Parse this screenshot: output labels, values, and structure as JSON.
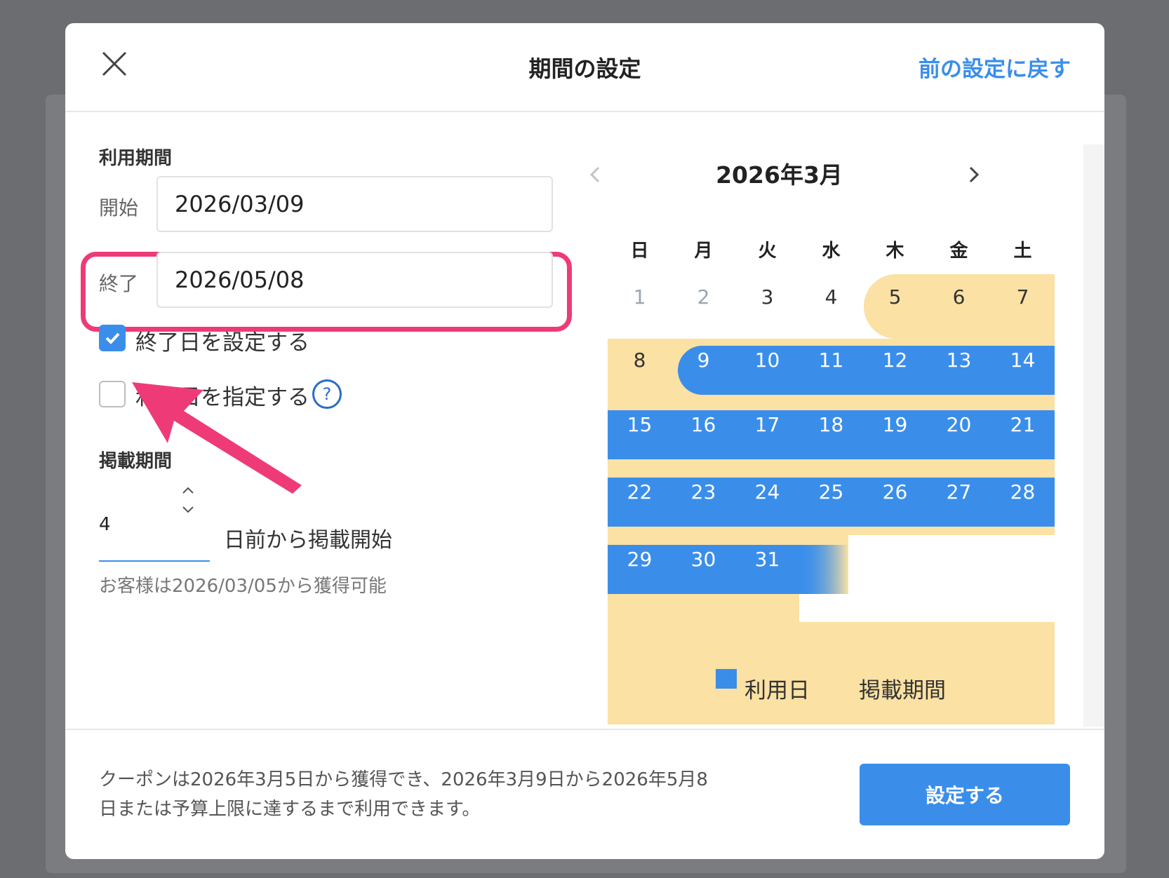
{
  "modal": {
    "title": "期間の設定",
    "reset_link": "前の設定に戻す"
  },
  "usage_period": {
    "section_title": "利用期間",
    "start_label": "開始",
    "start_value": "2026/03/09",
    "end_label": "終了",
    "end_value": "2026/05/08",
    "set_end_date_label": "終了日を設定する",
    "set_end_date_checked": true,
    "specify_usage_days_label": "利用日を指定する",
    "specify_usage_days_checked": false,
    "help_symbol": "?"
  },
  "publish_period": {
    "section_title": "掲載期間",
    "days_before_value": "4",
    "days_before_suffix": "日前から掲載開始",
    "note": "お客様は2026/03/05から獲得可能"
  },
  "calendar": {
    "month_label": "2026年3月",
    "weekdays": [
      "日",
      "月",
      "火",
      "水",
      "木",
      "金",
      "土"
    ],
    "weeks": [
      [
        "1",
        "2",
        "3",
        "4",
        "5",
        "6",
        "7"
      ],
      [
        "8",
        "9",
        "10",
        "11",
        "12",
        "13",
        "14"
      ],
      [
        "15",
        "16",
        "17",
        "18",
        "19",
        "20",
        "21"
      ],
      [
        "22",
        "23",
        "24",
        "25",
        "26",
        "27",
        "28"
      ],
      [
        "29",
        "30",
        "31"
      ]
    ],
    "publish_start_day": 5,
    "usage_start_day": 9
  },
  "legend": {
    "usage_label": "利用日",
    "publish_label": "掲載期間",
    "usage_color": "#3a8eea",
    "publish_color": "#fbe1a3"
  },
  "footer": {
    "summary": "クーポンは2026年3月5日から獲得でき、2026年3月9日から2026年5月8日または予算上限に達するまで利用できます。",
    "submit_label": "設定する"
  },
  "colors": {
    "accent": "#3a8eea",
    "highlight": "#ee3b78",
    "publish": "#fbe1a3"
  }
}
